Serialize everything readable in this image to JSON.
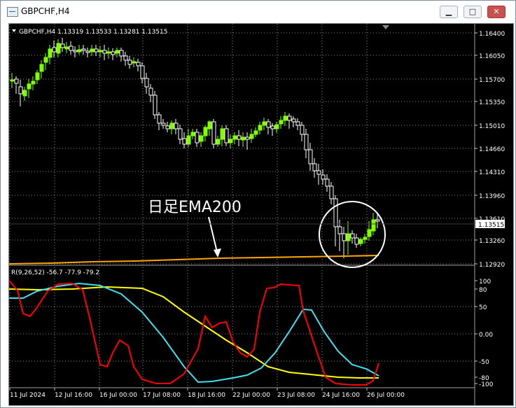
{
  "window": {
    "title": "GBPCHF,H4",
    "buttons": {
      "minimize": "▁",
      "maximize": "□",
      "close": "✕"
    }
  },
  "info_line": "GBPCHF,H4  1.13319 1.13533 1.13281 1.13515",
  "annotation": {
    "label": "日足EMA200"
  },
  "current_price_tag": "1.13515",
  "price_axis": {
    "ticks": [
      "1.16400",
      "1.16050",
      "1.15700",
      "1.15350",
      "1.15010",
      "1.14660",
      "1.14310",
      "1.13960",
      "1.13610",
      "1.13260",
      "1.12920"
    ]
  },
  "indicator": {
    "label": "R(9,26,52) -56.7 -77.9 -79.2",
    "ticks": [
      "100",
      "80",
      "50",
      "0.00",
      "-50",
      "-80",
      "-100"
    ]
  },
  "time_axis": {
    "ticks": [
      "11 Jul 2024",
      "12 Jul 16:00",
      "16 Jul 00:00",
      "17 Jul 08:00",
      "18 Jul 16:00",
      "22 Jul 00:00",
      "23 Jul 08:00",
      "24 Jul 16:00",
      "26 Jul 00:00"
    ]
  },
  "colors": {
    "background": "#000000",
    "bull": "#7fff00",
    "bear": "#ffffff",
    "ema": "#ffa500",
    "grid": "#ffffff",
    "line_red": "#ff0000",
    "line_cyan": "#40e0f0",
    "line_yellow": "#ffff00",
    "circle": "#ffffff"
  }
}
